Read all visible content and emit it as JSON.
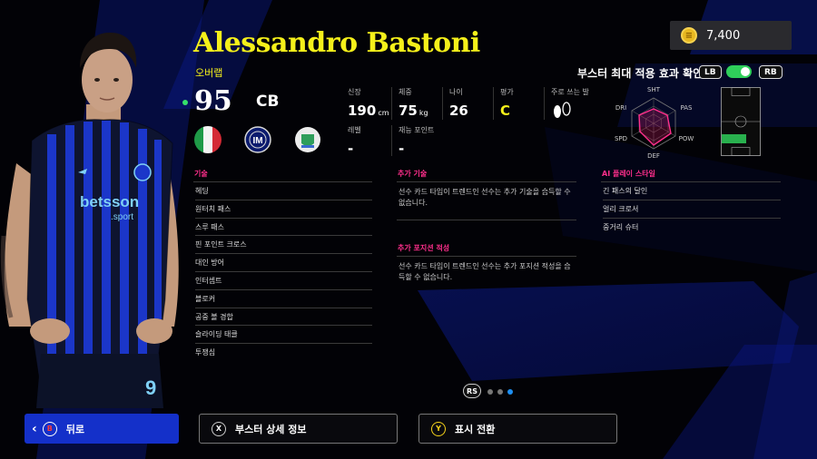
{
  "coins": {
    "amount": "7,400",
    "icon": "coin-icon"
  },
  "player": {
    "name": "Alessandro Bastoni",
    "card_type": "오버랩",
    "rating": "95",
    "position": "CB"
  },
  "stats": {
    "height": {
      "label": "신장",
      "value": "190",
      "unit": "cm"
    },
    "weight": {
      "label": "체중",
      "value": "75",
      "unit": "kg"
    },
    "age": {
      "label": "나이",
      "value": "26"
    },
    "grade": {
      "label": "평가",
      "value": "C"
    },
    "foot": {
      "label": "주로 쓰는 발",
      "icon": "footprints-icon"
    },
    "level": {
      "label": "레벨",
      "value": "-"
    },
    "talent": {
      "label": "재능 포인트",
      "value": "-"
    }
  },
  "booster": {
    "label": "부스터 최대 적용 효과 확인",
    "lb": "LB",
    "rb": "RB",
    "toggle_on": true
  },
  "radar": {
    "labels": [
      "SHT",
      "PAS",
      "POW",
      "DEF",
      "SPD",
      "DRI"
    ]
  },
  "skills": {
    "title": "기술",
    "items": [
      "헤딩",
      "원터치 패스",
      "스루 패스",
      "핀 포인트 크로스",
      "대인 방어",
      "인터셉트",
      "블로커",
      "공중 볼 경합",
      "슬라이딩 태클",
      "투쟁심"
    ]
  },
  "extra_skills": {
    "title": "추가 기술",
    "desc": "선수 카드 타입이 트렌드인 선수는 추가 기술을 습득할 수 없습니다."
  },
  "extra_positions": {
    "title": "추가 포지션 적성",
    "desc": "선수 카드 타입이 트렌드인 선수는 추가 포지션 적성을 습득할 수 없습니다."
  },
  "ai_styles": {
    "title": "AI 플레이 스타일",
    "items": [
      "긴 패스의 달인",
      "얼리 크로서",
      "중거리 슈터"
    ]
  },
  "pager": {
    "rs": "RS",
    "pages": 3,
    "current": 3
  },
  "buttons": {
    "back": {
      "key": "B",
      "label": "뒤로"
    },
    "booster_detail": {
      "key": "X",
      "label": "부스터 상세 정보"
    },
    "toggle_view": {
      "key": "Y",
      "label": "표시 전환"
    }
  },
  "colors": {
    "accent": "#f5f01a",
    "section": "#ff2f8c",
    "toggle": "#2fcf5a",
    "back": "#1430c9"
  }
}
